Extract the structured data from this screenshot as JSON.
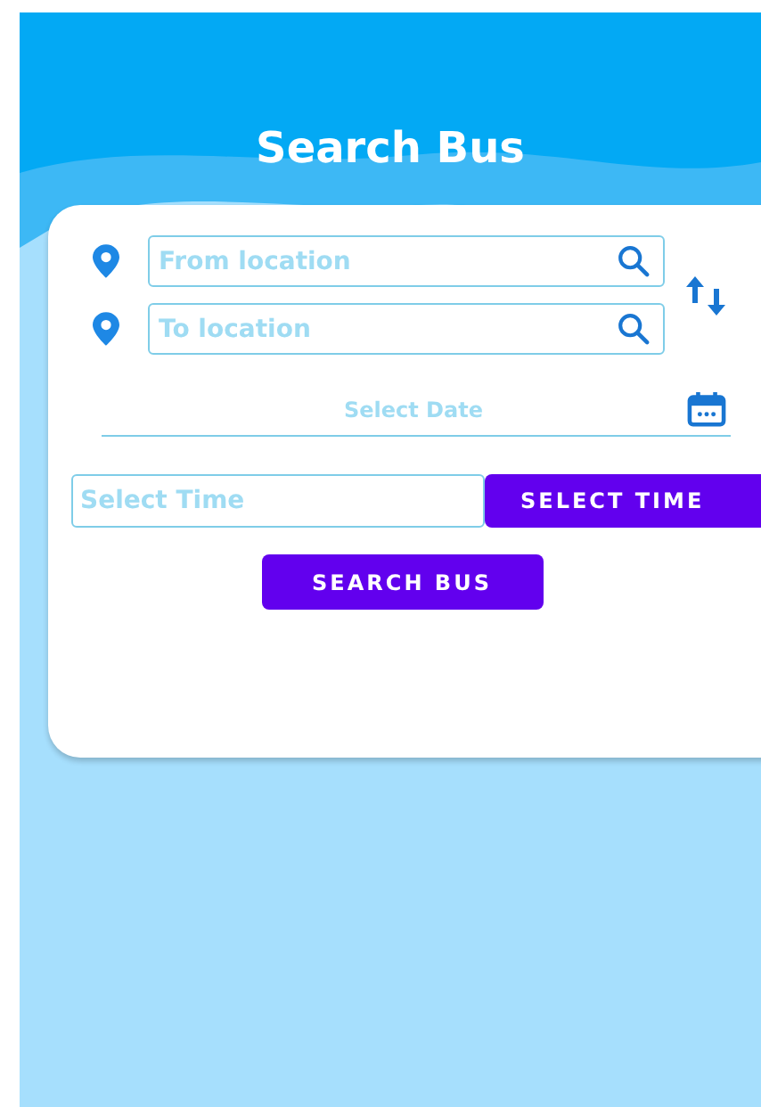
{
  "title": "Search Bus",
  "from_field": {
    "placeholder": "From location"
  },
  "to_field": {
    "placeholder": "To location"
  },
  "date_field": {
    "placeholder": "Select Date"
  },
  "time_field": {
    "placeholder": "Select Time"
  },
  "select_time_button": "SELECT TIME",
  "search_button": "SEARCH BUS"
}
